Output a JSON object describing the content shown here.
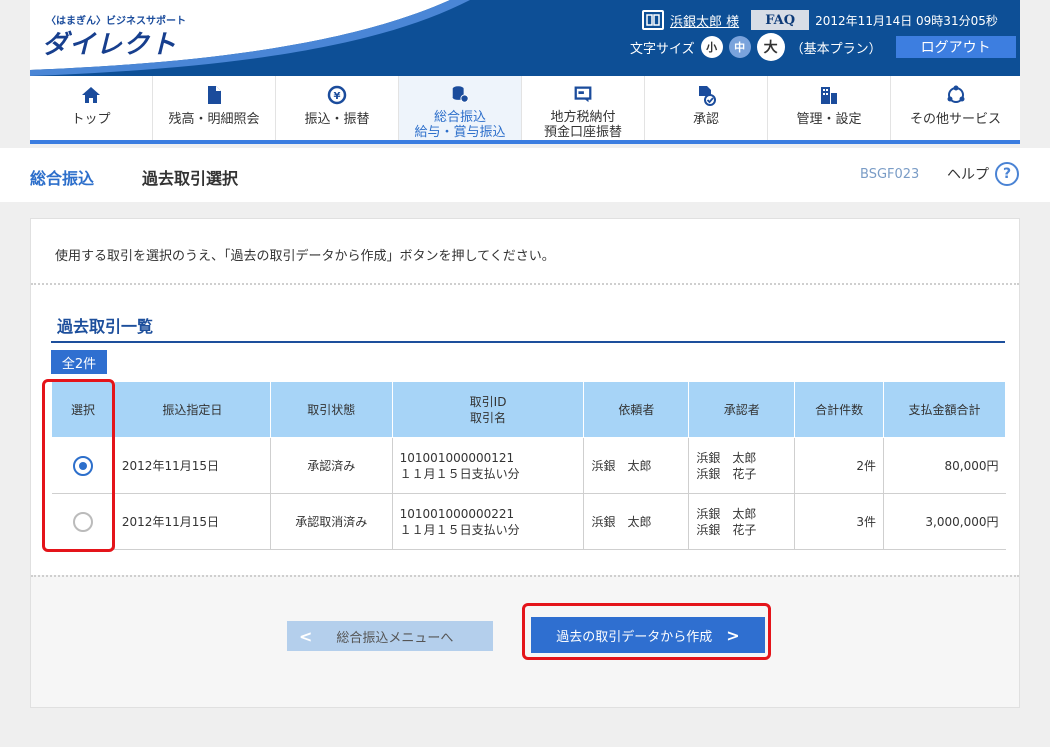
{
  "header": {
    "logo_small": "〈はまぎん〉ビジネスサポート",
    "logo_big": "ダイレクト",
    "mark": "マルヨ",
    "user_name": "浜銀太郎 様",
    "faq_label": "FAQ",
    "datetime": "2012年11月14日 09時31分05秒",
    "font_size_label": "文字サイズ",
    "font_small": "小",
    "font_medium": "中",
    "font_large": "大",
    "plan": "（基本プラン）",
    "logout_label": "ログアウト"
  },
  "nav": {
    "items": [
      {
        "label1": "トップ",
        "label2": "",
        "icon": "home-icon"
      },
      {
        "label1": "残高・明細照会",
        "label2": "",
        "icon": "document-icon"
      },
      {
        "label1": "振込・振替",
        "label2": "",
        "icon": "yen-transfer-icon"
      },
      {
        "label1": "総合振込",
        "label2": "給与・賞与振込",
        "icon": "coins-icon"
      },
      {
        "label1": "地方税納付",
        "label2": "預金口座振替",
        "icon": "tax-icon"
      },
      {
        "label1": "承認",
        "label2": "",
        "icon": "approve-icon"
      },
      {
        "label1": "管理・設定",
        "label2": "",
        "icon": "settings-building-icon"
      },
      {
        "label1": "その他サービス",
        "label2": "",
        "icon": "other-services-icon"
      }
    ]
  },
  "subheader": {
    "category": "総合振込",
    "title": "過去取引選択",
    "screen_id": "BSGF023",
    "help_label": "ヘルプ",
    "help_icon": "?"
  },
  "main": {
    "instruction": "使用する取引を選択のうえ、「過去の取引データから作成」ボタンを押してください。",
    "section_title": "過去取引一覧",
    "count_badge": "全2件",
    "table": {
      "headers": {
        "select": "選択",
        "date": "振込指定日",
        "status": "取引状態",
        "id": "取引ID",
        "name": "取引名",
        "requester": "依頼者",
        "approver": "承認者",
        "count": "合計件数",
        "amount": "支払金額合計"
      },
      "rows": [
        {
          "selected": true,
          "date": "2012年11月15日",
          "status": "承認済み",
          "id": "101001000000121",
          "name": "１１月１５日支払い分",
          "requester": "浜銀　太郎",
          "approver1": "浜銀　太郎",
          "approver2": "浜銀　花子",
          "count": "2件",
          "amount": "80,000円"
        },
        {
          "selected": false,
          "date": "2012年11月15日",
          "status": "承認取消済み",
          "id": "101001000000221",
          "name": "１１月１５日支払い分",
          "requester": "浜銀　太郎",
          "approver1": "浜銀　太郎",
          "approver2": "浜銀　花子",
          "count": "3件",
          "amount": "3,000,000円"
        }
      ]
    },
    "back_button": "総合振込メニューへ",
    "create_button": "過去の取引データから作成"
  },
  "colors": {
    "header_bg": "#0d4f96",
    "accent": "#2f6fd0",
    "table_header": "#a7d4f7",
    "highlight_frame": "#e4141a"
  }
}
